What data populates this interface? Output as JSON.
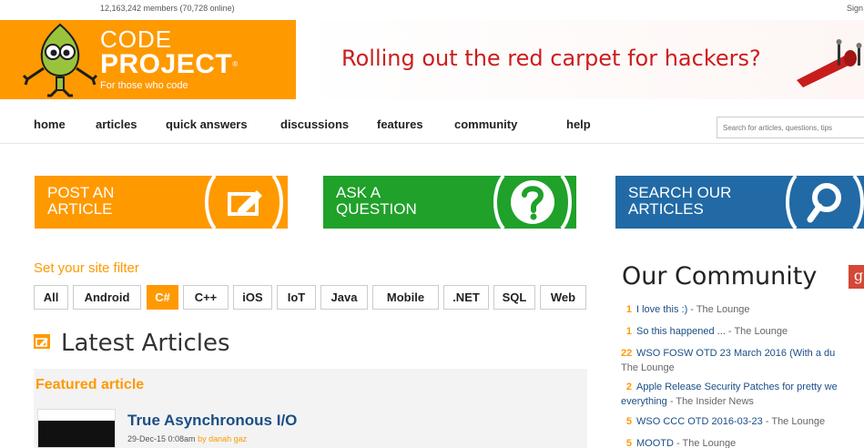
{
  "header": {
    "members": "12,163,242 members (70,728 online)",
    "signin": "Sign"
  },
  "logo": {
    "line1": "CODE",
    "line2": "PROJECT",
    "reg": "®",
    "tagline": "For those who code"
  },
  "ad": {
    "text": "Rolling out the red carpet for hackers?"
  },
  "nav": {
    "items": [
      "home",
      "articles",
      "quick answers",
      "discussions",
      "features",
      "community",
      "help"
    ],
    "search_placeholder": "Search for articles, questions, tips"
  },
  "cta": {
    "post_line1": "POST AN",
    "post_line2": "ARTICLE",
    "ask_line1": "ASK A",
    "ask_line2": "QUESTION",
    "search_line1": "SEARCH OUR",
    "search_line2": "ARTICLES"
  },
  "filter": {
    "label": "Set your site filter",
    "options": [
      "All",
      "Android",
      "C#",
      "C++",
      "iOS",
      "IoT",
      "Java",
      "Mobile",
      ".NET",
      "SQL",
      "Web"
    ],
    "selected": "C#"
  },
  "latest": {
    "title": "Latest Articles",
    "featured_label": "Featured article",
    "article_title": "True Asynchronous I/O",
    "article_date": "29-Dec-15 0:08am",
    "article_by": "by",
    "article_author": "danah gaz"
  },
  "community": {
    "title": "Our Community",
    "gplus": "g",
    "items": [
      {
        "num": "1",
        "text": "I love this :)",
        "sep": " - ",
        "src": "The Lounge"
      },
      {
        "num": "1",
        "text": "So this happened ...",
        "sep": " - ",
        "src": "The Lounge"
      },
      {
        "num": "22",
        "text": "WSO FOSW OTD 23 March 2016 (With a du",
        "sep": "",
        "src": ""
      },
      {
        "num": "",
        "text": "",
        "sep": "",
        "src": "The Lounge"
      },
      {
        "num": "2",
        "text": "Apple Release Security Patches for pretty we",
        "sep": "",
        "src": ""
      },
      {
        "num": "",
        "text": "everything",
        "sep": " - ",
        "src": "The Insider News"
      },
      {
        "num": "5",
        "text": "WSO CCC OTD 2016-03-23",
        "sep": " - ",
        "src": "The Lounge"
      },
      {
        "num": "5",
        "text": "MOOTD",
        "sep": " - ",
        "src": "The Lounge"
      }
    ]
  }
}
